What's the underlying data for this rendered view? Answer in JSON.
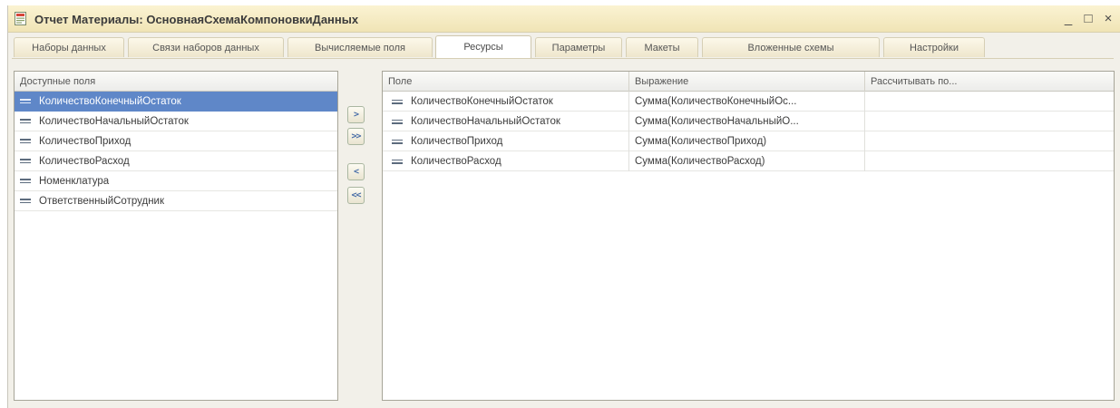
{
  "window": {
    "title": "Отчет Материалы: ОсновнаяСхемаКомпоновкиДанных",
    "minimize_label": "_",
    "maximize_label": "□",
    "close_label": "×"
  },
  "tabs": [
    {
      "label": "Наборы данных"
    },
    {
      "label": "Связи наборов данных"
    },
    {
      "label": "Вычисляемые поля"
    },
    {
      "label": "Ресурсы"
    },
    {
      "label": "Параметры"
    },
    {
      "label": "Макеты"
    },
    {
      "label": "Вложенные схемы"
    },
    {
      "label": "Настройки"
    }
  ],
  "active_tab": "Ресурсы",
  "available_fields": {
    "header": "Доступные поля",
    "items": [
      {
        "label": "КоличествоКонечныйОстаток",
        "selected": true
      },
      {
        "label": "КоличествоНачальныйОстаток"
      },
      {
        "label": "КоличествоПриход"
      },
      {
        "label": "КоличествоРасход"
      },
      {
        "label": "Номенклатура"
      },
      {
        "label": "ОтветственныйСотрудник"
      }
    ]
  },
  "move_buttons": {
    "add": ">",
    "add_all": ">>",
    "remove": "<",
    "remove_all": "<<"
  },
  "resources": {
    "columns": [
      "Поле",
      "Выражение",
      "Рассчитывать по..."
    ],
    "rows": [
      {
        "field": "КоличествоКонечныйОстаток",
        "expression": "Сумма(КоличествоКонечныйОс...",
        "calc_by": ""
      },
      {
        "field": "КоличествоНачальныйОстаток",
        "expression": "Сумма(КоличествоНачальныйО...",
        "calc_by": ""
      },
      {
        "field": "КоличествоПриход",
        "expression": "Сумма(КоличествоПриход)",
        "calc_by": ""
      },
      {
        "field": "КоличествоРасход",
        "expression": "Сумма(КоличествоРасход)",
        "calc_by": ""
      }
    ]
  },
  "colors": {
    "selection": "#5f87c8",
    "titlebar": "#f0e4b6",
    "button_arrow": "#4a6fa8"
  }
}
